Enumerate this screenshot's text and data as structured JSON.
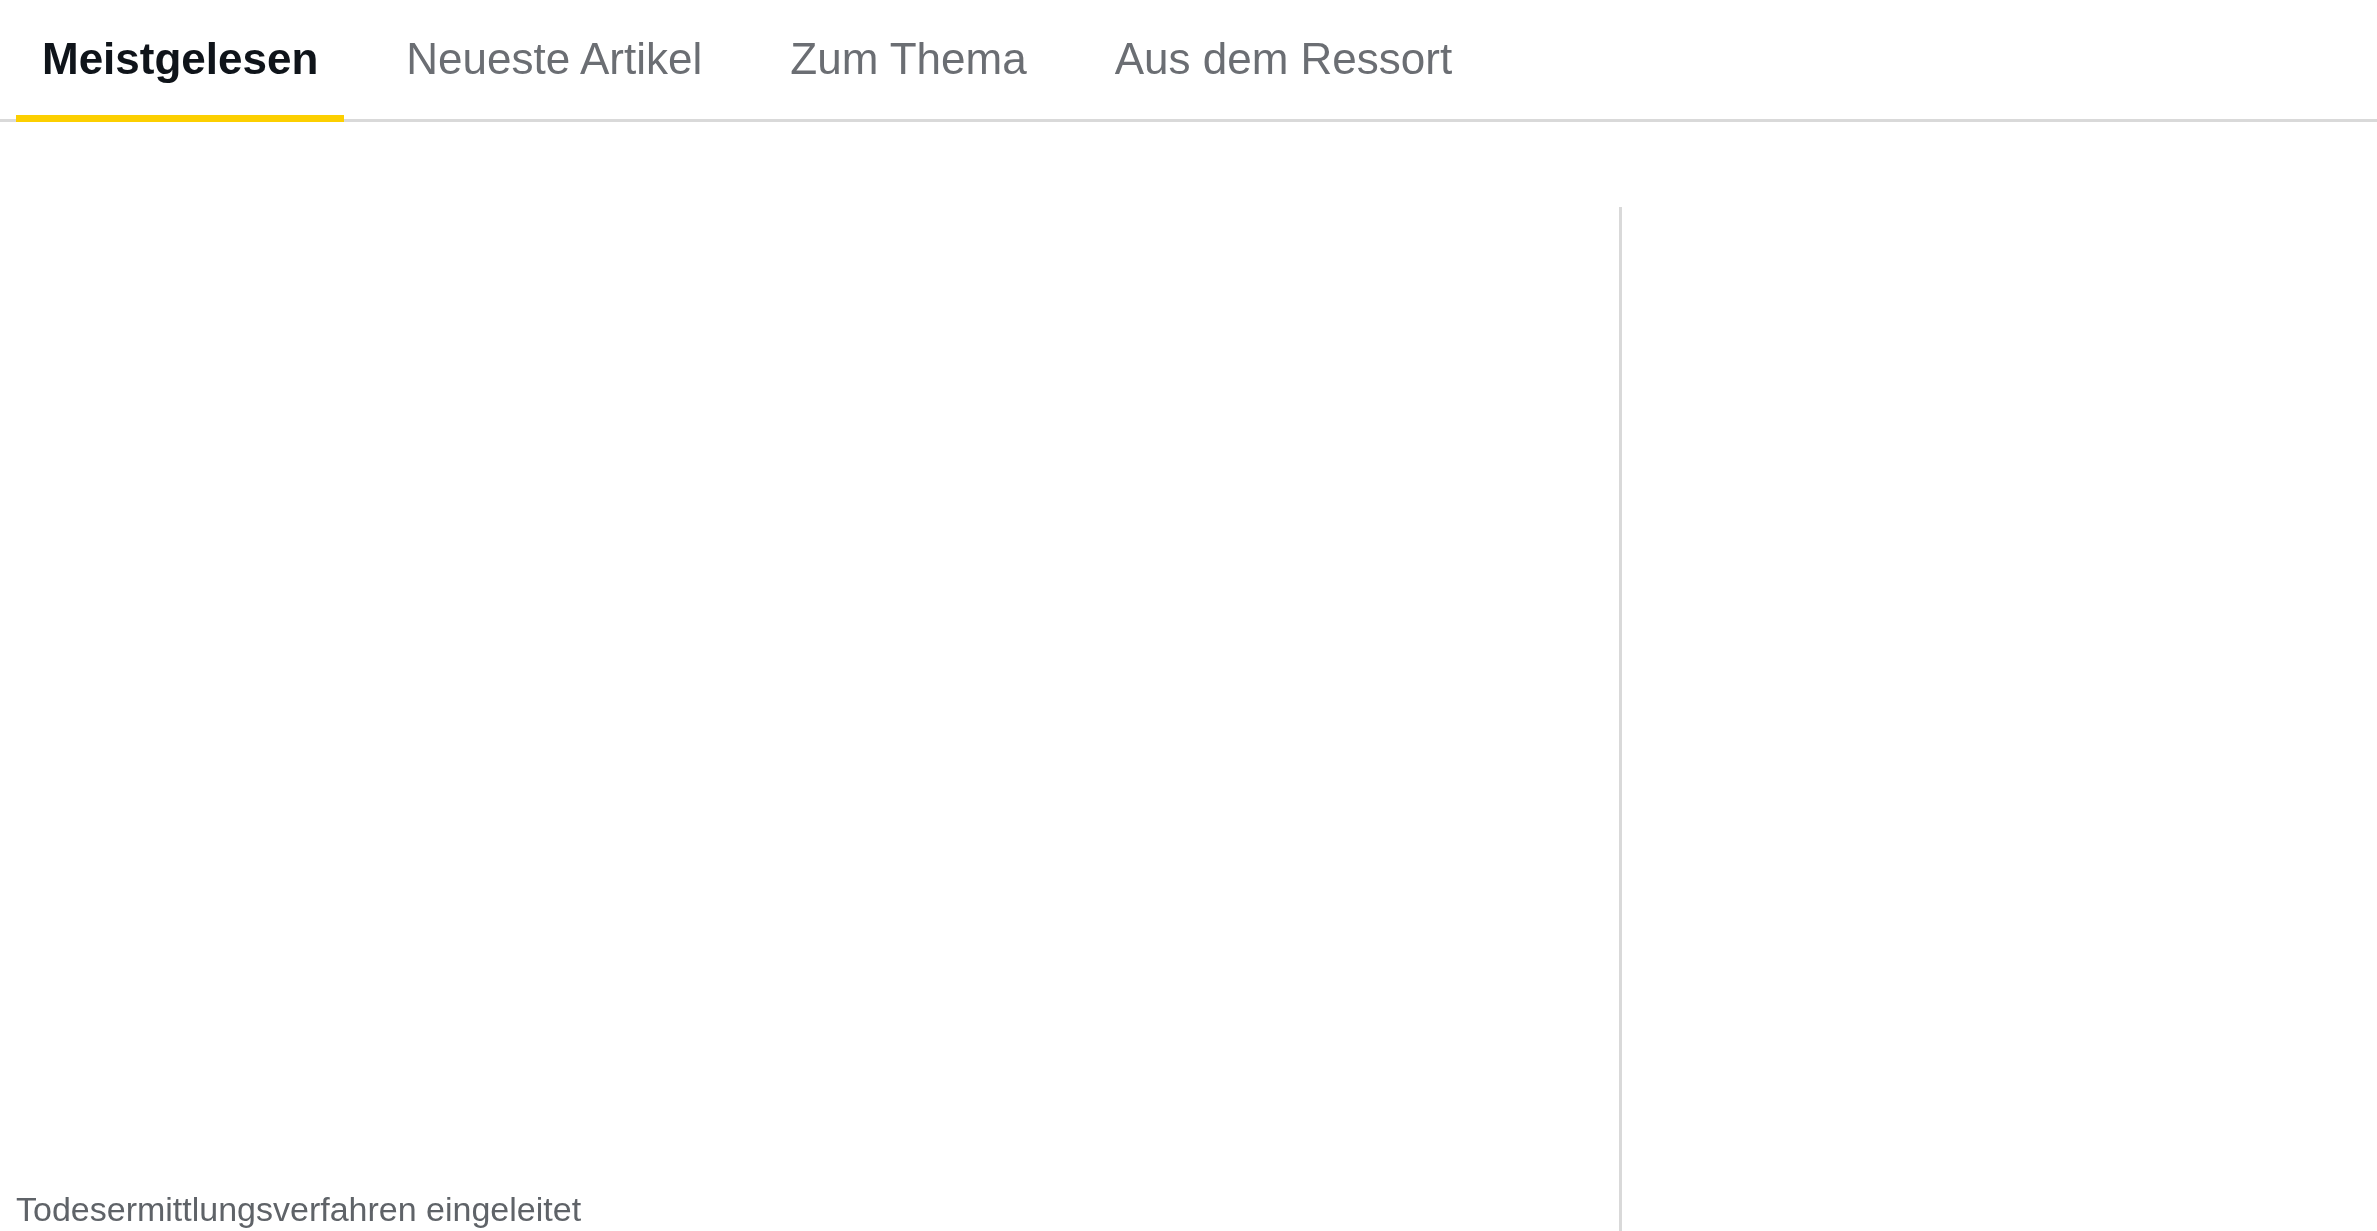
{
  "tabs": [
    {
      "label": "Meistgelesen",
      "selected": true
    },
    {
      "label": "Neueste Artikel",
      "selected": false
    },
    {
      "label": "Zum Thema",
      "selected": false
    },
    {
      "label": "Aus dem Ressort",
      "selected": false
    }
  ],
  "articles": [
    {
      "title": "Todesermittlungsverfahren eingeleitet"
    }
  ]
}
